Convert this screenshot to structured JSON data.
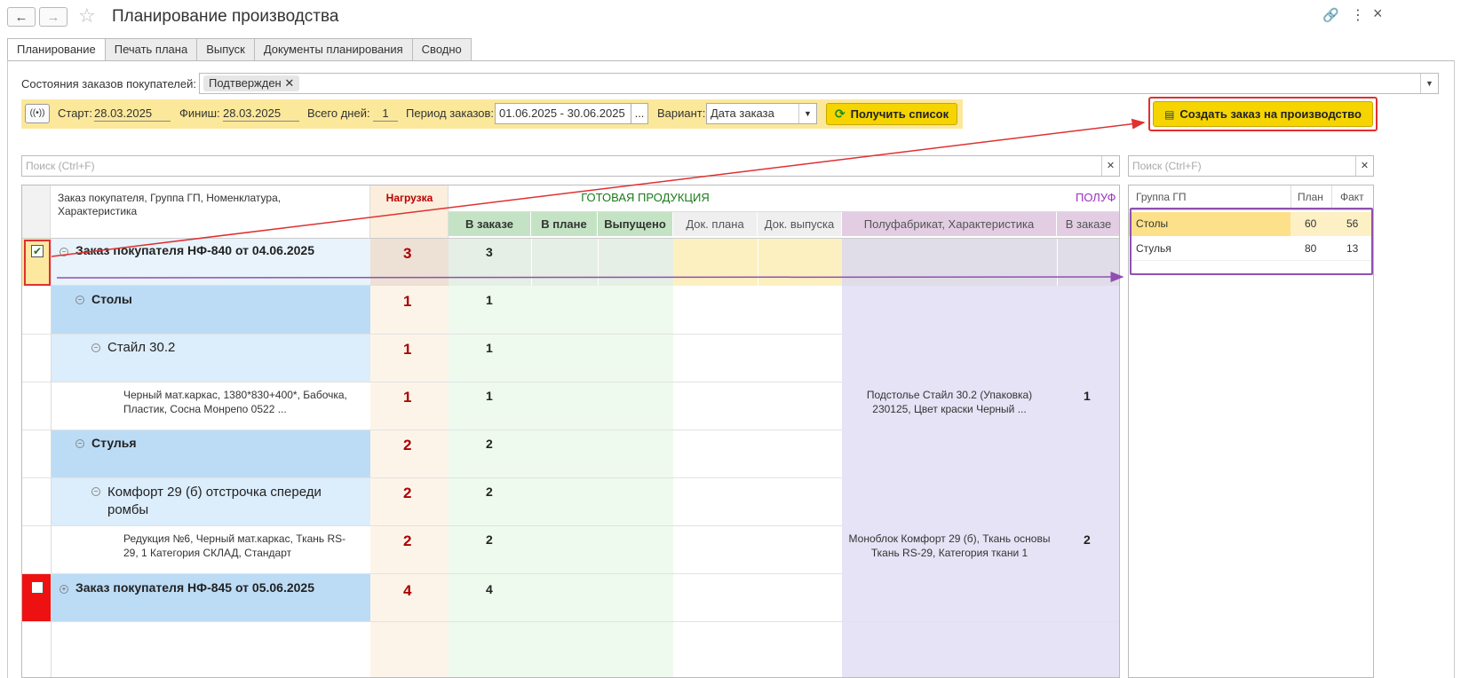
{
  "window": {
    "title": "Планирование производства"
  },
  "tabs": [
    "Планирование",
    "Печать плана",
    "Выпуск",
    "Документы планирования",
    "Сводно"
  ],
  "filters": {
    "states_label": "Состояния заказов покупателей:",
    "states_chip": "Подтвержден",
    "start_label": "Старт:",
    "start_value": "28.03.2025",
    "finish_label": "Финиш:",
    "finish_value": "28.03.2025",
    "days_label": "Всего дней:",
    "days_value": "1",
    "period_label": "Период заказов:",
    "period_value": "01.06.2025 - 30.06.2025",
    "variant_label": "Вариант:",
    "variant_value": "Дата заказа",
    "get_list_button": "Получить список",
    "create_order_button": "Создать заказ на производство"
  },
  "search": {
    "placeholder": "Поиск (Ctrl+F)"
  },
  "grid": {
    "col_main": "Заказ покупателя, Группа ГП, Номенклатура, Характеристика",
    "col_load": "Нагрузка",
    "group_ready": "ГОТОВАЯ ПРОДУКЦИЯ",
    "group_semi": "ПОЛУФ",
    "sub": [
      "В заказе",
      "В плане",
      "Выпущено",
      "Док. плана",
      "Док. выпуска",
      "Полуфабрикат, Характеристика",
      "В заказе"
    ],
    "rows": [
      {
        "text": "Заказ покупателя НФ-840 от 04.06.2025",
        "load": "3",
        "qty": "3",
        "semi": "",
        "semi_qty": ""
      },
      {
        "text": "Столы",
        "load": "1",
        "qty": "1",
        "semi": "",
        "semi_qty": ""
      },
      {
        "text": "Стайл 30.2",
        "load": "1",
        "qty": "1",
        "semi": "",
        "semi_qty": ""
      },
      {
        "text": "Черный мат.каркас, 1380*830+400*, Бабочка, Пластик, Сосна Монрепо 0522 ...",
        "load": "1",
        "qty": "1",
        "semi": "Подстолье Стайл 30.2 (Упаковка) 230125, Цвет краски Черный ...",
        "semi_qty": "1"
      },
      {
        "text": "Стулья",
        "load": "2",
        "qty": "2",
        "semi": "",
        "semi_qty": ""
      },
      {
        "text": "Комфорт 29 (б) отстрочка спереди ромбы",
        "load": "2",
        "qty": "2",
        "semi": "",
        "semi_qty": ""
      },
      {
        "text": "Редукция №6, Черный мат.каркас, Ткань RS-29, 1 Категория СКЛАД, Стандарт",
        "load": "2",
        "qty": "2",
        "semi": "Моноблок Комфорт 29 (б), Ткань основы Ткань RS-29, Категория ткани 1",
        "semi_qty": "2"
      },
      {
        "text": "Заказ покупателя НФ-845 от 05.06.2025",
        "load": "4",
        "qty": "4",
        "semi": "",
        "semi_qty": ""
      }
    ]
  },
  "summary": {
    "headers": [
      "Группа ГП",
      "План",
      "Факт"
    ],
    "rows": [
      {
        "group": "Столы",
        "plan": "60",
        "fact": "56"
      },
      {
        "group": "Стулья",
        "plan": "80",
        "fact": "13"
      }
    ]
  },
  "colors": {
    "accent_yellow": "#f5d400",
    "highlight_red": "#e03030",
    "arrow_purple": "#9050b0"
  }
}
